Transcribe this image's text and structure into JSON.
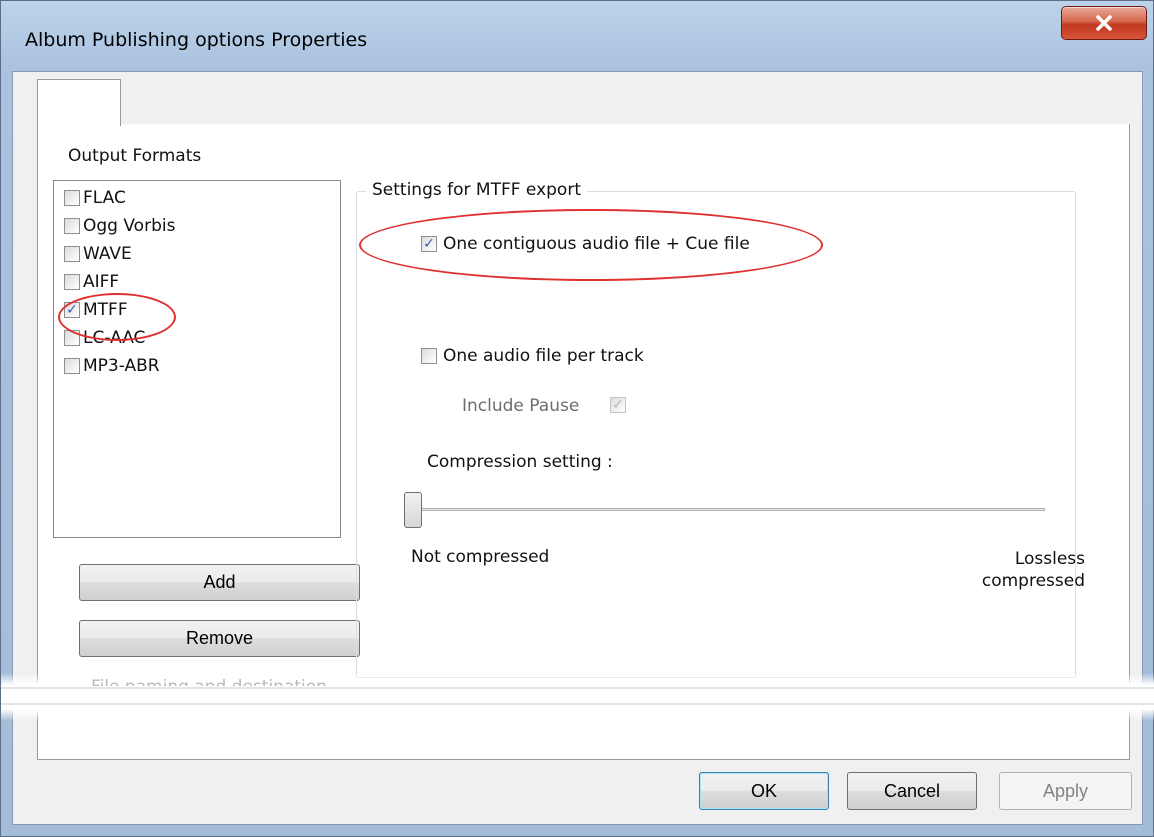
{
  "window": {
    "title": "Album Publishing options Properties",
    "close_glyph": "X"
  },
  "tabs": [
    {
      "label": ""
    }
  ],
  "output_formats": {
    "label": "Output Formats",
    "items": [
      {
        "label": "FLAC",
        "checked": false
      },
      {
        "label": "Ogg Vorbis",
        "checked": false
      },
      {
        "label": "WAVE",
        "checked": false
      },
      {
        "label": "AIFF",
        "checked": false
      },
      {
        "label": "MTFF",
        "checked": true
      },
      {
        "label": "LC-AAC",
        "checked": false
      },
      {
        "label": "MP3-ABR",
        "checked": false
      }
    ],
    "add_label": "Add",
    "remove_label": "Remove"
  },
  "settings": {
    "group_title": "Settings for MTFF export",
    "contiguous": {
      "label": "One contiguous audio file + Cue file",
      "checked": true
    },
    "per_track": {
      "label": "One audio file per track",
      "checked": false
    },
    "include_pause": {
      "label": "Include Pause",
      "checked": true,
      "disabled": true
    },
    "compression": {
      "label": "Compression setting :",
      "min_label": "Not compressed",
      "max_label_line1": "Lossless",
      "max_label_line2": "compressed",
      "value_fraction": 0.0
    }
  },
  "file_naming_label": "File naming and destination",
  "footer": {
    "ok_label": "OK",
    "cancel_label": "Cancel",
    "apply_label": "Apply"
  },
  "check_glyph": "✓",
  "colors": {
    "annotation": "#e03030",
    "check": "#3b5dab"
  }
}
